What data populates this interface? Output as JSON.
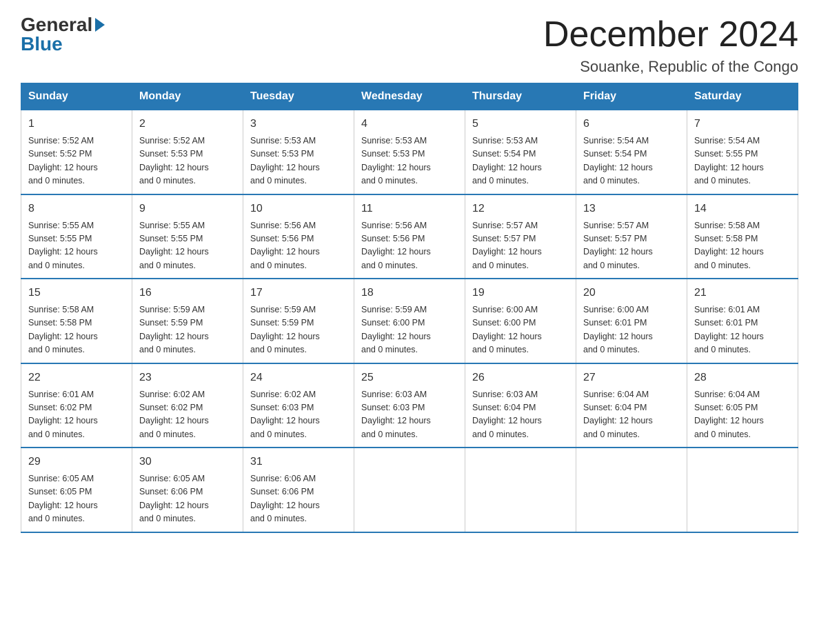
{
  "header": {
    "logo_general": "General",
    "logo_blue": "Blue",
    "month_title": "December 2024",
    "location": "Souanke, Republic of the Congo"
  },
  "days_of_week": [
    "Sunday",
    "Monday",
    "Tuesday",
    "Wednesday",
    "Thursday",
    "Friday",
    "Saturday"
  ],
  "weeks": [
    [
      {
        "day": "1",
        "sunrise": "5:52 AM",
        "sunset": "5:52 PM",
        "daylight": "12 hours and 0 minutes."
      },
      {
        "day": "2",
        "sunrise": "5:52 AM",
        "sunset": "5:53 PM",
        "daylight": "12 hours and 0 minutes."
      },
      {
        "day": "3",
        "sunrise": "5:53 AM",
        "sunset": "5:53 PM",
        "daylight": "12 hours and 0 minutes."
      },
      {
        "day": "4",
        "sunrise": "5:53 AM",
        "sunset": "5:53 PM",
        "daylight": "12 hours and 0 minutes."
      },
      {
        "day": "5",
        "sunrise": "5:53 AM",
        "sunset": "5:54 PM",
        "daylight": "12 hours and 0 minutes."
      },
      {
        "day": "6",
        "sunrise": "5:54 AM",
        "sunset": "5:54 PM",
        "daylight": "12 hours and 0 minutes."
      },
      {
        "day": "7",
        "sunrise": "5:54 AM",
        "sunset": "5:55 PM",
        "daylight": "12 hours and 0 minutes."
      }
    ],
    [
      {
        "day": "8",
        "sunrise": "5:55 AM",
        "sunset": "5:55 PM",
        "daylight": "12 hours and 0 minutes."
      },
      {
        "day": "9",
        "sunrise": "5:55 AM",
        "sunset": "5:55 PM",
        "daylight": "12 hours and 0 minutes."
      },
      {
        "day": "10",
        "sunrise": "5:56 AM",
        "sunset": "5:56 PM",
        "daylight": "12 hours and 0 minutes."
      },
      {
        "day": "11",
        "sunrise": "5:56 AM",
        "sunset": "5:56 PM",
        "daylight": "12 hours and 0 minutes."
      },
      {
        "day": "12",
        "sunrise": "5:57 AM",
        "sunset": "5:57 PM",
        "daylight": "12 hours and 0 minutes."
      },
      {
        "day": "13",
        "sunrise": "5:57 AM",
        "sunset": "5:57 PM",
        "daylight": "12 hours and 0 minutes."
      },
      {
        "day": "14",
        "sunrise": "5:58 AM",
        "sunset": "5:58 PM",
        "daylight": "12 hours and 0 minutes."
      }
    ],
    [
      {
        "day": "15",
        "sunrise": "5:58 AM",
        "sunset": "5:58 PM",
        "daylight": "12 hours and 0 minutes."
      },
      {
        "day": "16",
        "sunrise": "5:59 AM",
        "sunset": "5:59 PM",
        "daylight": "12 hours and 0 minutes."
      },
      {
        "day": "17",
        "sunrise": "5:59 AM",
        "sunset": "5:59 PM",
        "daylight": "12 hours and 0 minutes."
      },
      {
        "day": "18",
        "sunrise": "5:59 AM",
        "sunset": "6:00 PM",
        "daylight": "12 hours and 0 minutes."
      },
      {
        "day": "19",
        "sunrise": "6:00 AM",
        "sunset": "6:00 PM",
        "daylight": "12 hours and 0 minutes."
      },
      {
        "day": "20",
        "sunrise": "6:00 AM",
        "sunset": "6:01 PM",
        "daylight": "12 hours and 0 minutes."
      },
      {
        "day": "21",
        "sunrise": "6:01 AM",
        "sunset": "6:01 PM",
        "daylight": "12 hours and 0 minutes."
      }
    ],
    [
      {
        "day": "22",
        "sunrise": "6:01 AM",
        "sunset": "6:02 PM",
        "daylight": "12 hours and 0 minutes."
      },
      {
        "day": "23",
        "sunrise": "6:02 AM",
        "sunset": "6:02 PM",
        "daylight": "12 hours and 0 minutes."
      },
      {
        "day": "24",
        "sunrise": "6:02 AM",
        "sunset": "6:03 PM",
        "daylight": "12 hours and 0 minutes."
      },
      {
        "day": "25",
        "sunrise": "6:03 AM",
        "sunset": "6:03 PM",
        "daylight": "12 hours and 0 minutes."
      },
      {
        "day": "26",
        "sunrise": "6:03 AM",
        "sunset": "6:04 PM",
        "daylight": "12 hours and 0 minutes."
      },
      {
        "day": "27",
        "sunrise": "6:04 AM",
        "sunset": "6:04 PM",
        "daylight": "12 hours and 0 minutes."
      },
      {
        "day": "28",
        "sunrise": "6:04 AM",
        "sunset": "6:05 PM",
        "daylight": "12 hours and 0 minutes."
      }
    ],
    [
      {
        "day": "29",
        "sunrise": "6:05 AM",
        "sunset": "6:05 PM",
        "daylight": "12 hours and 0 minutes."
      },
      {
        "day": "30",
        "sunrise": "6:05 AM",
        "sunset": "6:06 PM",
        "daylight": "12 hours and 0 minutes."
      },
      {
        "day": "31",
        "sunrise": "6:06 AM",
        "sunset": "6:06 PM",
        "daylight": "12 hours and 0 minutes."
      },
      {
        "day": "",
        "sunrise": "",
        "sunset": "",
        "daylight": ""
      },
      {
        "day": "",
        "sunrise": "",
        "sunset": "",
        "daylight": ""
      },
      {
        "day": "",
        "sunrise": "",
        "sunset": "",
        "daylight": ""
      },
      {
        "day": "",
        "sunrise": "",
        "sunset": "",
        "daylight": ""
      }
    ]
  ],
  "labels": {
    "sunrise": "Sunrise:",
    "sunset": "Sunset:",
    "daylight": "Daylight:"
  }
}
